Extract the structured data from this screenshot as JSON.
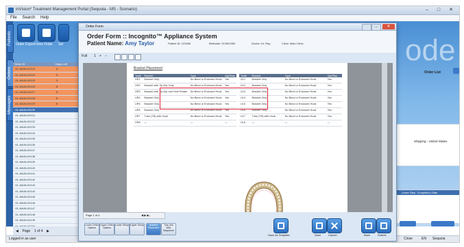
{
  "app": {
    "title": "inVision* Treatment Management Portal (Sequoia - MS - Scenario)",
    "menu": [
      "File",
      "Search",
      "Help"
    ],
    "watermark": "ode"
  },
  "vtabs": [
    "Patients",
    "Orders",
    "Messages"
  ],
  "ribbon": {
    "labels": [
      "Order Export",
      "View Order",
      "Sel"
    ]
  },
  "orders_list": {
    "header": [
      "Order ID",
      "Days Left"
    ],
    "rows": [
      {
        "id": "OL-MAIN-00123",
        "n": "3",
        "style": "orange"
      },
      {
        "id": "OL-MAIN-00124",
        "n": "3",
        "style": "orange"
      },
      {
        "id": "OL-MAIN-00125",
        "n": "3",
        "style": "orange"
      },
      {
        "id": "OL-MAIN-00126",
        "n": "5",
        "style": "orange"
      },
      {
        "id": "OL-MAIN-00127",
        "n": "5",
        "style": "orange"
      },
      {
        "id": "OL-MAIN-00128",
        "n": "5",
        "style": "orange"
      },
      {
        "id": "OL-MAIN-00129",
        "n": "5",
        "style": "orange"
      },
      {
        "id": "OL-MAIN-00130",
        "n": "",
        "style": "sel"
      },
      {
        "id": "OL-MAIN-00131",
        "n": "",
        "style": ""
      },
      {
        "id": "OL-MAIN-00132",
        "n": "",
        "style": ""
      },
      {
        "id": "OL-MAIN-00133",
        "n": "",
        "style": ""
      },
      {
        "id": "OL-MAIN-00134",
        "n": "",
        "style": ""
      },
      {
        "id": "OL-MAIN-00135",
        "n": "",
        "style": ""
      },
      {
        "id": "OL-MAIN-00136",
        "n": "",
        "style": ""
      },
      {
        "id": "OL-MAIN-00137",
        "n": "",
        "style": ""
      },
      {
        "id": "OL-MAIN-00138",
        "n": "",
        "style": ""
      },
      {
        "id": "OL-MAIN-00139",
        "n": "",
        "style": ""
      },
      {
        "id": "OL-MAIN-00140",
        "n": "",
        "style": ""
      },
      {
        "id": "OL-MAIN-00141",
        "n": "",
        "style": ""
      },
      {
        "id": "OL-MAIN-00142",
        "n": "",
        "style": ""
      },
      {
        "id": "OL-MAIN-00143",
        "n": "",
        "style": ""
      },
      {
        "id": "OL-MAIN-00144",
        "n": "",
        "style": ""
      },
      {
        "id": "OL-MAIN-00145",
        "n": "",
        "style": ""
      },
      {
        "id": "OL-MAIN-00146",
        "n": "",
        "style": ""
      },
      {
        "id": "OL-MAIN-00147",
        "n": "",
        "style": ""
      },
      {
        "id": "OL-MAIN-00148",
        "n": "",
        "style": ""
      },
      {
        "id": "OL-MAIN-00149",
        "n": "",
        "style": ""
      },
      {
        "id": "OL-MAIN-00150",
        "n": "",
        "style": ""
      },
      {
        "id": "OL-MAIN-00151",
        "n": "",
        "style": ""
      },
      {
        "id": "OL-MAIN-00152",
        "n": "",
        "style": ""
      }
    ],
    "nav": {
      "prev": "◀",
      "page": "Page",
      "num": "1 of 4",
      "next": "▶"
    }
  },
  "status": {
    "left": "Logged in as user",
    "right": [
      "Close",
      "EN",
      "Sequoia"
    ]
  },
  "right_panel": {
    "order_label": "Order List",
    "ship_label": "Shipping - United States",
    "grid_headers": [
      "Lower Step",
      "Completion Date"
    ]
  },
  "modal": {
    "title": "Order Form",
    "heading": "Order Form :: Incognito™ Appliance System",
    "patient_label": "Patient Name:",
    "patient_name": "Amy Taylor",
    "meta": [
      "Patient ID: 123456",
      "Birthdate: 01/08/1990",
      "Doctor: Dr. Ray",
      "Clinic: Main Clinic"
    ],
    "toolbar": {
      "zoom": "Full",
      "nums": "1"
    },
    "sheet_title": "Bracket Placement",
    "table_headers": [
      "Tooth",
      "Bracket",
      "Type",
      "Qty/Step"
    ],
    "left_rows": [
      [
        "UR1",
        "Bracket Only",
        "No Bend or Enclosed Hook",
        "Yes"
      ],
      [
        "UR2",
        "Bracket with Tip Adj. Only",
        "No Bend or Enclosed Hook",
        "Yes"
      ],
      [
        "UR3",
        "Bracket with Tip Adj. and Hole Rotate",
        "No Bend or Enclosed Hook",
        "Yes"
      ],
      [
        "UR4",
        "Bracket Only",
        "No Bend or Enclosed Hook",
        "Yes"
      ],
      [
        "UR5",
        "Bracket Only",
        "No Bend or Enclosed Hook",
        "Yes"
      ],
      [
        "UR6",
        "Bracket Only",
        "No Bend or Enclosed Hook",
        "Yes"
      ],
      [
        "UR7",
        "Tube (TB) with Hook",
        "No Bend or Enclosed Hook",
        "Yes"
      ],
      [
        "UR8",
        "—",
        "—",
        "—"
      ]
    ],
    "right_rows": [
      [
        "UL1",
        "Bracket Only",
        "No Bend or Enclosed Hook",
        "Yes"
      ],
      [
        "UL2",
        "Bracket Only",
        "No Bend or Enclosed Hook",
        "Yes"
      ],
      [
        "UL3",
        "Bracket Only",
        "No Bend or Enclosed Hook",
        "Yes"
      ],
      [
        "UL4",
        "Bracket Only",
        "No Bend or Enclosed Hook",
        "Yes"
      ],
      [
        "UL5",
        "Bracket Only",
        "No Bend or Enclosed Hook",
        "Yes"
      ],
      [
        "UL6",
        "Bracket Only",
        "No Bend or Enclosed Hook",
        "Yes"
      ],
      [
        "UL7",
        "Tube (TB) with Hook",
        "No Bend or Enclosed Hook",
        "Yes"
      ],
      [
        "UL8",
        "—",
        "—",
        "—"
      ]
    ],
    "pager": {
      "text": "Page 1 of 4",
      "arrows": "◀ ▶ ▶|"
    },
    "bottom_buttons": [
      "Lower Ortho Options",
      "Upper Ortho Options",
      "Lower Setup",
      "Upper Setup",
      "Bracket Placement",
      "Tray and Wire Sequence"
    ],
    "big_buttons": [
      "Save as Template",
      "Save",
      "Cancel",
      "Back",
      "Submit"
    ]
  },
  "colors": {
    "orange_row": "#f2955f",
    "accent": "#3b7ac8",
    "highlight_box": "#e0263a"
  }
}
